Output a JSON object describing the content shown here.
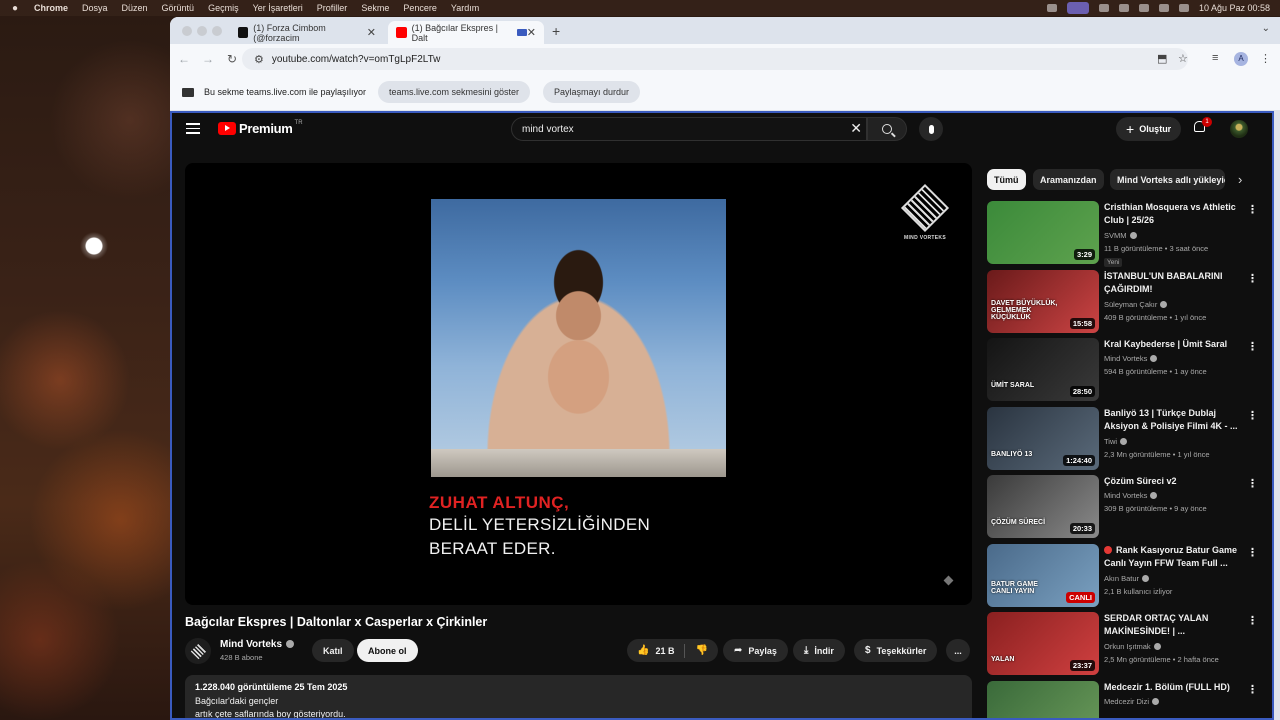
{
  "menubar": {
    "items": [
      "Chrome",
      "Dosya",
      "Düzen",
      "Görüntü",
      "Geçmiş",
      "Yer İşaretleri",
      "Profiller",
      "Sekme",
      "Pencere",
      "Yardım"
    ],
    "clock": "10 Ağu Paz  00:58"
  },
  "browser": {
    "tabs": [
      {
        "title": "(1) Forza Cimbom (@forzacim",
        "active": false
      },
      {
        "title": "(1) Bağcılar Ekspres | Dalt",
        "active": true
      }
    ],
    "url": "youtube.com/watch?v=omTgLpF2LTw",
    "profile_initial": "A"
  },
  "sharebar": {
    "message": "Bu sekme teams.live.com ile paylaşılıyor",
    "show_button": "teams.live.com sekmesini göster",
    "stop_button": "Paylaşmayı durdur"
  },
  "youtube": {
    "brand": "Premium",
    "region": "TR",
    "search_value": "mind vortex",
    "create_label": "Oluştur",
    "notification_count": "1",
    "video": {
      "caption_red": "ZUHAT ALTUNÇ,",
      "caption_line2": "DELİL YETERSİZLİĞİNDEN",
      "caption_line3": "BERAAT EDER.",
      "watermark": "MIND VORTEKS",
      "title": "Bağcılar Ekspres | Daltonlar x Casperlar x Çirkinler"
    },
    "channel": {
      "name": "Mind Vorteks",
      "subscribers": "428 B abone",
      "join_label": "Katıl",
      "subscribe_label": "Abone ol"
    },
    "actions": {
      "likes": "21 B",
      "share": "Paylaş",
      "download": "İndir",
      "thanks": "Teşekkürler",
      "more": "..."
    },
    "description": {
      "meta": "1.228.040 görüntüleme  25 Tem 2025",
      "line1": "Bağcılar'daki gençler",
      "line2": "artık çete saflarında boy gösteriyordu."
    },
    "chips": [
      "Tümü",
      "Aramanızdan",
      "Mind Vorteks adlı yükleyiciden"
    ],
    "recommendations": [
      {
        "title": "Cristhian Mosquera vs Athletic Club | 25/26",
        "channel": "SVMM",
        "meta": "11 B görüntüleme • 3 saat önce",
        "badge": "Yeni",
        "duration": "3:29",
        "colors": [
          "#3b8a3a",
          "#5ea24e"
        ]
      },
      {
        "title": "İSTANBUL'UN BABALARINI ÇAĞIRDIM!",
        "channel": "Süleyman Çakır",
        "meta": "409 B görüntüleme • 1 yıl önce",
        "duration": "15:58",
        "thumb_text": "DAVET BÜYÜKLÜK, GELMEMEK KÜÇÜKLÜK",
        "colors": [
          "#6a1a1a",
          "#c44"
        ]
      },
      {
        "title": "Kral Kaybederse | Ümit Saral",
        "channel": "Mind Vorteks",
        "meta": "594 B görüntüleme • 1 ay önce",
        "duration": "28:50",
        "thumb_text": "ÜMİT SARAL",
        "colors": [
          "#141414",
          "#3a3a3a"
        ]
      },
      {
        "title": "Banliyö 13 | Türkçe Dublaj Aksiyon & Polisiye Filmi 4K - ...",
        "channel": "Tiwi",
        "meta": "2,3 Mn görüntüleme • 1 yıl önce",
        "duration": "1:24:40",
        "thumb_text": "BANLIYÖ 13",
        "colors": [
          "#2a3440",
          "#5a6a7a"
        ]
      },
      {
        "title": "Çözüm Süreci v2",
        "channel": "Mind Vorteks",
        "meta": "309 B görüntüleme • 9 ay önce",
        "duration": "20:33",
        "thumb_text": "ÇÖZÜM SÜRECİ",
        "colors": [
          "#3a3a3a",
          "#8a8a8a"
        ]
      },
      {
        "title": "Rank Kasıyoruz Batur Game Canlı Yayın   FFW Team Full ...",
        "channel": "Akın Batur",
        "meta": "2,1 B kullanıcı izliyor",
        "duration": "CANLI",
        "live": true,
        "thumb_text": "BATUR GAME CANLI YAYIN",
        "colors": [
          "#4a6a8a",
          "#7aa0c0"
        ]
      },
      {
        "title": "SERDAR ORTAÇ YALAN MAKİNESİNDE! | ...",
        "channel": "Orkun Işıtmak",
        "meta": "2,5 Mn görüntüleme • 2 hafta önce",
        "duration": "23:37",
        "thumb_text": "YALAN",
        "colors": [
          "#8a2020",
          "#d04040"
        ]
      },
      {
        "title": "Medcezir 1. Bölüm (FULL HD)",
        "channel": "Medcezir Dizi",
        "meta": "",
        "duration": "",
        "colors": [
          "#3a6a3a",
          "#6a9a5a"
        ]
      }
    ]
  },
  "colors": {
    "accent_red": "#ff0000",
    "share_border": "#3a5bbf"
  }
}
